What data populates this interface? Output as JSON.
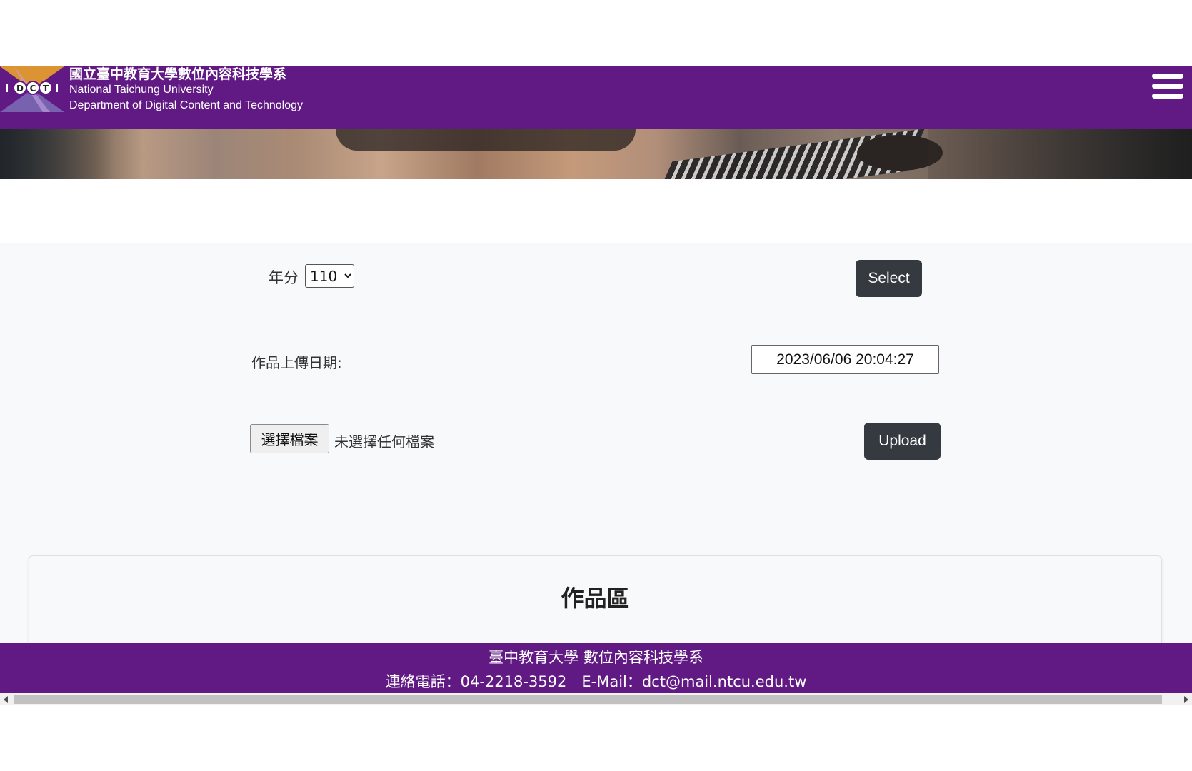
{
  "header": {
    "logo_letters": "DCT",
    "title_zh": "國立臺中教育大學數位內容科技學系",
    "title_en_1": "National Taichung University",
    "title_en_2": "Department of Digital Content and Technology",
    "background_color": "#611983",
    "menu_icon": "hamburger-menu-icon"
  },
  "form": {
    "year_label": "年分",
    "year_selected": "110",
    "select_button": "Select",
    "date_label": "作品上傳日期:",
    "date_value": "2023/06/06 20:04:27",
    "file_button": "選擇檔案",
    "file_status": "未選擇任何檔案",
    "upload_button": "Upload"
  },
  "works": {
    "title": "作品區"
  },
  "footer": {
    "line1": "臺中教育大學 數位內容科技學系",
    "line2": "連絡電話：04-2218-3592　E-Mail：dct@mail.ntcu.edu.tw"
  }
}
